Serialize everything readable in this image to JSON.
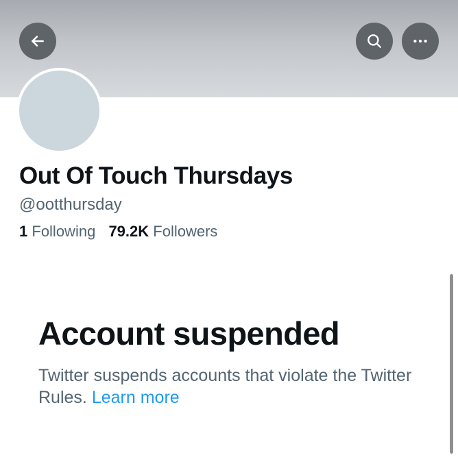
{
  "header": {
    "back_icon": "arrow-left-icon",
    "search_icon": "search-icon",
    "more_icon": "more-horizontal-icon"
  },
  "profile": {
    "display_name": "Out Of Touch Thursdays",
    "handle": "@ootthursday",
    "following_count": "1",
    "following_label": "Following",
    "followers_count": "79.2K",
    "followers_label": "Followers"
  },
  "suspension": {
    "title": "Account suspended",
    "description": "Twitter suspends accounts that violate the Twitter Rules.",
    "link_text": "Learn more",
    "link_color": "#1d9bf0"
  }
}
